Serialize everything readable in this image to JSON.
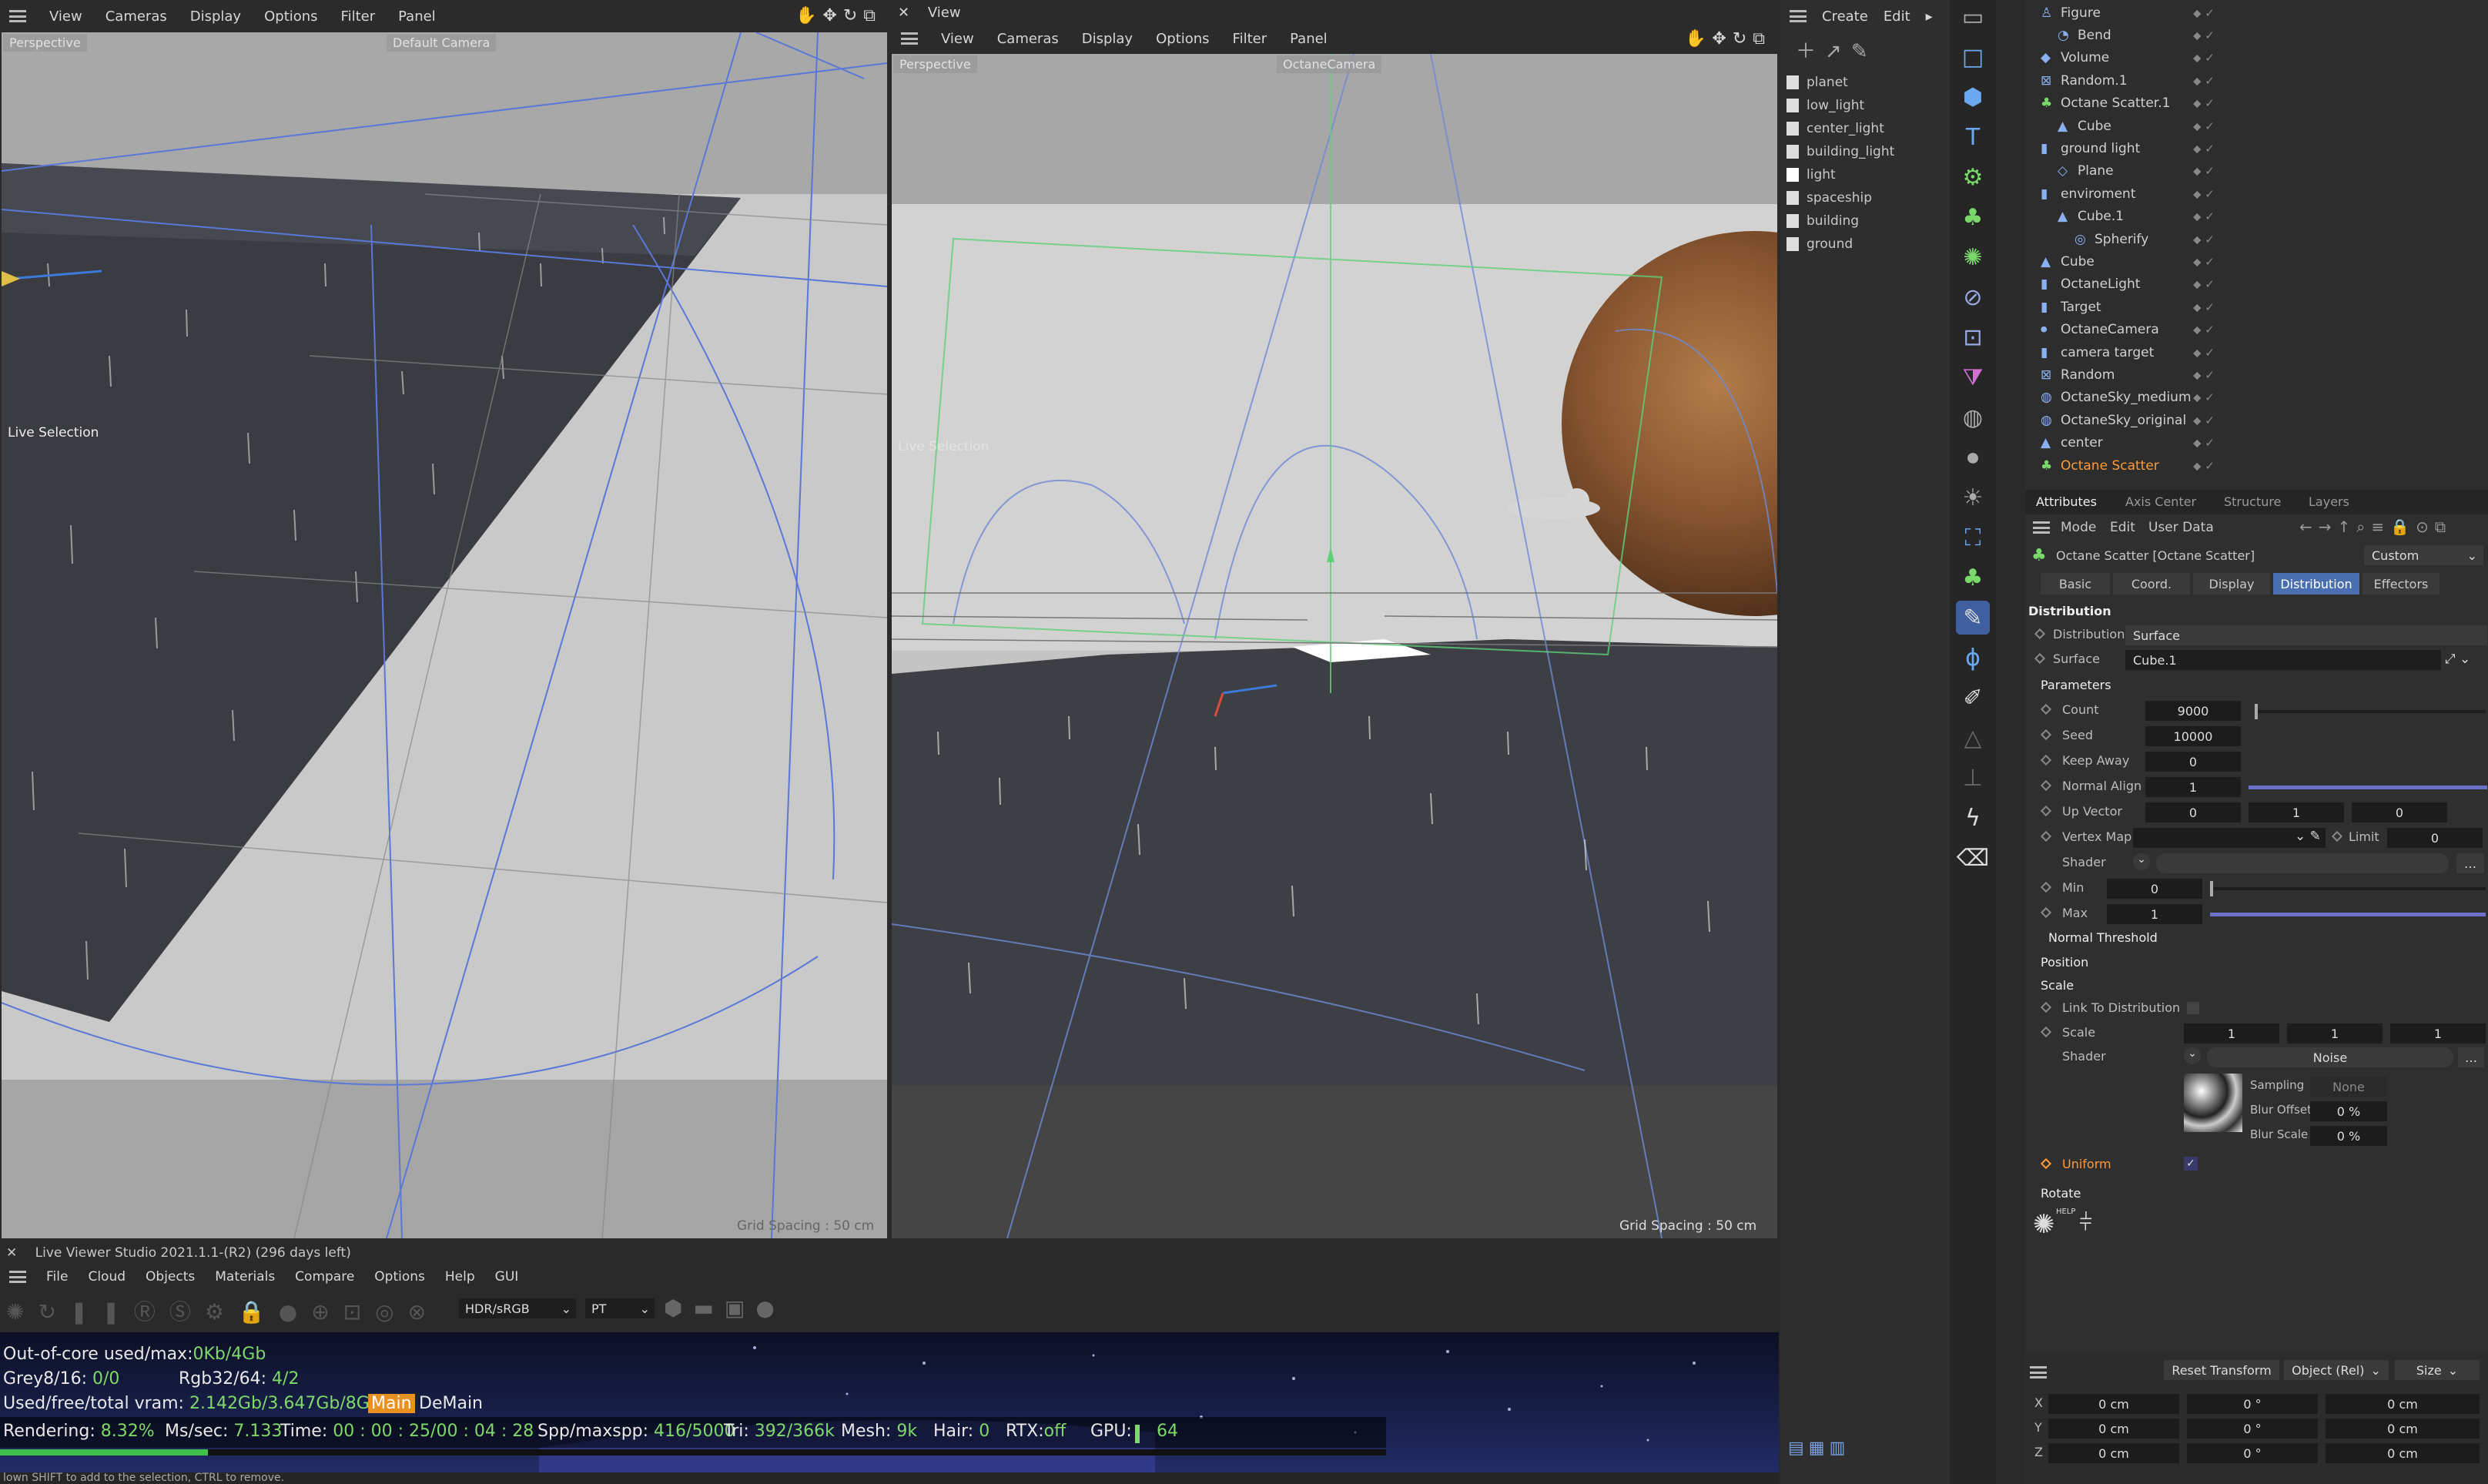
{
  "left_viewport": {
    "menu": [
      "View",
      "Cameras",
      "Display",
      "Options",
      "Filter",
      "Panel"
    ],
    "label": "Perspective",
    "camera": "Default Camera",
    "live_selection": "Live Selection",
    "grid": "Grid Spacing : 50 cm"
  },
  "right_viewport": {
    "title": "View",
    "menu": [
      "View",
      "Cameras",
      "Display",
      "Options",
      "Filter",
      "Panel"
    ],
    "label": "Perspective",
    "camera": "OctaneCamera",
    "live_selection": "Live Selection",
    "grid": "Grid Spacing : 50 cm"
  },
  "create_panel": {
    "menu": [
      "Create",
      "Edit"
    ],
    "items": [
      "planet",
      "low_light",
      "center_light",
      "building_light",
      "light",
      "spaceship",
      "building",
      "ground"
    ]
  },
  "object_tree": [
    {
      "name": "Figure",
      "indent": 0
    },
    {
      "name": "Bend",
      "indent": 1
    },
    {
      "name": "Volume",
      "indent": 0
    },
    {
      "name": "Random.1",
      "indent": 0
    },
    {
      "name": "Octane Scatter.1",
      "indent": 0
    },
    {
      "name": "Cube",
      "indent": 1
    },
    {
      "name": "ground light",
      "indent": 0
    },
    {
      "name": "Plane",
      "indent": 1
    },
    {
      "name": "enviroment",
      "indent": 0
    },
    {
      "name": "Cube.1",
      "indent": 1
    },
    {
      "name": "Spherify",
      "indent": 2
    },
    {
      "name": "Cube",
      "indent": 0
    },
    {
      "name": "OctaneLight",
      "indent": 0
    },
    {
      "name": "Target",
      "indent": 0
    },
    {
      "name": "OctaneCamera",
      "indent": 0
    },
    {
      "name": "camera target",
      "indent": 0
    },
    {
      "name": "Random",
      "indent": 0
    },
    {
      "name": "OctaneSky_medium",
      "indent": 0
    },
    {
      "name": "OctaneSky_original",
      "indent": 0
    },
    {
      "name": "center",
      "indent": 0
    },
    {
      "name": "Octane Scatter",
      "indent": 0,
      "selected": true
    }
  ],
  "attributes": {
    "tabs": [
      "Attributes",
      "Axis Center",
      "Structure",
      "Layers"
    ],
    "menu": [
      "Mode",
      "Edit",
      "User Data"
    ],
    "object": "Octane Scatter [Octane Scatter]",
    "preset": "Custom",
    "subtabs": [
      "Basic",
      "Coord.",
      "Display",
      "Distribution",
      "Effectors"
    ],
    "active_subtab": "Distribution",
    "section": "Distribution",
    "distribution": {
      "label": "Distribution",
      "value": "Surface"
    },
    "surface": {
      "label": "Surface",
      "value": "Cube.1"
    },
    "parameters_label": "Parameters",
    "count": {
      "label": "Count",
      "value": "9000"
    },
    "seed": {
      "label": "Seed",
      "value": "10000"
    },
    "keep_away": {
      "label": "Keep Away",
      "value": "0"
    },
    "normal_align": {
      "label": "Normal Align",
      "value": "1"
    },
    "up_vector": {
      "label": "Up Vector",
      "values": [
        "0",
        "1",
        "0"
      ]
    },
    "vertex_map": {
      "label": "Vertex Map",
      "limit_label": "Limit",
      "limit": "0"
    },
    "shader_label": "Shader",
    "min": {
      "label": "Min",
      "value": "0"
    },
    "max": {
      "label": "Max",
      "value": "1"
    },
    "normal_threshold": "Normal Threshold",
    "position": "Position",
    "scale_section": "Scale",
    "link_to_distribution": "Link To Distribution",
    "scale": {
      "label": "Scale",
      "values": [
        "1",
        "1",
        "1"
      ]
    },
    "scale_shader": {
      "label": "Shader",
      "value": "Noise"
    },
    "sampling": {
      "label": "Sampling",
      "value": "None"
    },
    "blur_offset": {
      "label": "Blur Offset",
      "value": "0 %"
    },
    "blur_scale": {
      "label": "Blur Scale",
      "value": "0 %"
    },
    "uniform": "Uniform",
    "rotate": "Rotate",
    "help": "HELP"
  },
  "coords": {
    "reset": "Reset Transform",
    "mode": "Object (Rel)",
    "size": "Size",
    "rows": [
      {
        "axis": "X",
        "pos": "0 cm",
        "rot": "0 °",
        "size": "0 cm"
      },
      {
        "axis": "Y",
        "pos": "0 cm",
        "rot": "0 °",
        "size": "0 cm"
      },
      {
        "axis": "Z",
        "pos": "0 cm",
        "rot": "0 °",
        "size": "0 cm"
      }
    ]
  },
  "live_viewer": {
    "title": "Live Viewer Studio 2021.1.1-(R2) (296 days left)",
    "menu": [
      "File",
      "Cloud",
      "Objects",
      "Materials",
      "Compare",
      "Options",
      "Help",
      "GUI"
    ],
    "color_space": "HDR/sRGB",
    "kernel": "PT",
    "ooc_label": "Out-of-core used/max:",
    "ooc_value": "0Kb/4Gb",
    "grey_label": "Grey8/16:",
    "grey_value": "0/0",
    "rgb_label": "Rgb32/64:",
    "rgb_value": "4/2",
    "vram_label": "Used/free/total vram:",
    "vram_value": "2.142Gb/3.647Gb/8Gb",
    "main_btn": "Main",
    "demain": "DeMain",
    "rendering_label": "Rendering:",
    "rendering_value": "8.32%",
    "progress": 0.0832,
    "ms_label": "Ms/sec:",
    "ms_value": "7.133",
    "time_label": "Time:",
    "time_value": "00 : 00 : 25/00 : 04 : 28",
    "spp_label": "Spp/maxspp:",
    "spp_value": "416/5000",
    "tri_label": "Tri:",
    "tri_value": "392/366k",
    "mesh_label": "Mesh:",
    "mesh_value": "9k",
    "hair_label": "Hair:",
    "hair_value": "0",
    "rtx_label": "RTX:",
    "rtx_value": "off",
    "gpu_label": "GPU:",
    "gpu_value": "64"
  },
  "status_bar": "lown SHIFT to add to the selection, CTRL to remove.",
  "colors": {
    "accent": "#ff9a3a",
    "selected_tab": "#4a6fb0",
    "green": "#7fd96a"
  }
}
